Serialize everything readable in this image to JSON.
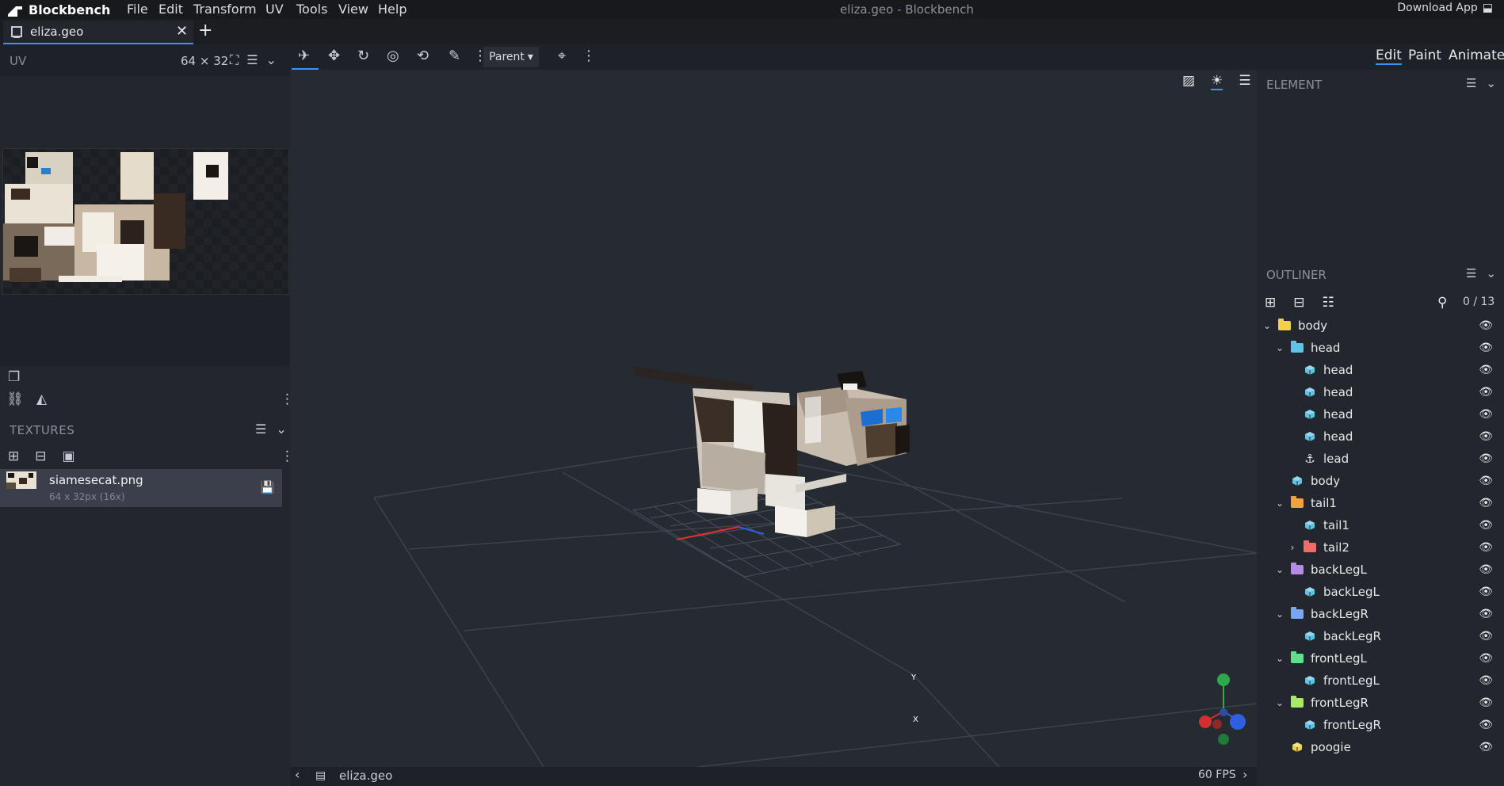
{
  "app": {
    "name": "Blockbench",
    "window_title": "eliza.geo - Blockbench",
    "menus": [
      "File",
      "Edit",
      "Transform",
      "UV",
      "Tools",
      "View",
      "Help"
    ],
    "download_label": "Download App"
  },
  "tabs": [
    {
      "label": "eliza.geo"
    }
  ],
  "uv": {
    "title": "UV",
    "size": "64 ⨯ 32"
  },
  "textures": {
    "title": "TEXTURES",
    "items": [
      {
        "name": "siamesecat.png",
        "size": "64 x 32px (16x)"
      }
    ]
  },
  "toolbar": {
    "parent_label": "Parent"
  },
  "modes": {
    "edit": "Edit",
    "paint": "Paint",
    "animate": "Animate"
  },
  "panels": {
    "element_title": "ELEMENT",
    "outliner_title": "OUTLINER",
    "outliner_count": "0 / 13"
  },
  "outliner": [
    {
      "label": "body",
      "type": "folder",
      "color": "#f2d04c",
      "depth": 0,
      "expanded": true
    },
    {
      "label": "head",
      "type": "folder",
      "color": "#5fc3e8",
      "depth": 1,
      "expanded": true
    },
    {
      "label": "head",
      "type": "cube",
      "color": "#5fc3e8",
      "depth": 2
    },
    {
      "label": "head",
      "type": "cube",
      "color": "#5fc3e8",
      "depth": 2
    },
    {
      "label": "head",
      "type": "cube",
      "color": "#5fc3e8",
      "depth": 2
    },
    {
      "label": "head",
      "type": "cube",
      "color": "#5fc3e8",
      "depth": 2
    },
    {
      "label": "lead",
      "type": "locator",
      "color": "#e6e8ee",
      "depth": 2
    },
    {
      "label": "body",
      "type": "cube",
      "color": "#5fc3e8",
      "depth": 1
    },
    {
      "label": "tail1",
      "type": "folder",
      "color": "#f0a33c",
      "depth": 1,
      "expanded": true
    },
    {
      "label": "tail1",
      "type": "cube",
      "color": "#5fc3e8",
      "depth": 2
    },
    {
      "label": "tail2",
      "type": "folder",
      "color": "#f06b6b",
      "depth": 2,
      "expanded": false
    },
    {
      "label": "backLegL",
      "type": "folder",
      "color": "#b48ce8",
      "depth": 1,
      "expanded": true
    },
    {
      "label": "backLegL",
      "type": "cube",
      "color": "#5fc3e8",
      "depth": 2
    },
    {
      "label": "backLegR",
      "type": "folder",
      "color": "#7aa6f0",
      "depth": 1,
      "expanded": true
    },
    {
      "label": "backLegR",
      "type": "cube",
      "color": "#5fc3e8",
      "depth": 2
    },
    {
      "label": "frontLegL",
      "type": "folder",
      "color": "#5fe08a",
      "depth": 1,
      "expanded": true
    },
    {
      "label": "frontLegL",
      "type": "cube",
      "color": "#5fc3e8",
      "depth": 2
    },
    {
      "label": "frontLegR",
      "type": "folder",
      "color": "#a8e86a",
      "depth": 1,
      "expanded": true
    },
    {
      "label": "frontLegR",
      "type": "cube",
      "color": "#5fc3e8",
      "depth": 2
    },
    {
      "label": "poogie",
      "type": "cube",
      "color": "#f2d04c",
      "depth": 1
    }
  ],
  "status": {
    "file": "eliza.geo",
    "fps": "60 FPS"
  },
  "gizmo": {
    "x": "X",
    "y": "Y"
  },
  "colors": {
    "accent": "#3e90ff",
    "panel": "#23262d",
    "viewport": "#262a31"
  }
}
